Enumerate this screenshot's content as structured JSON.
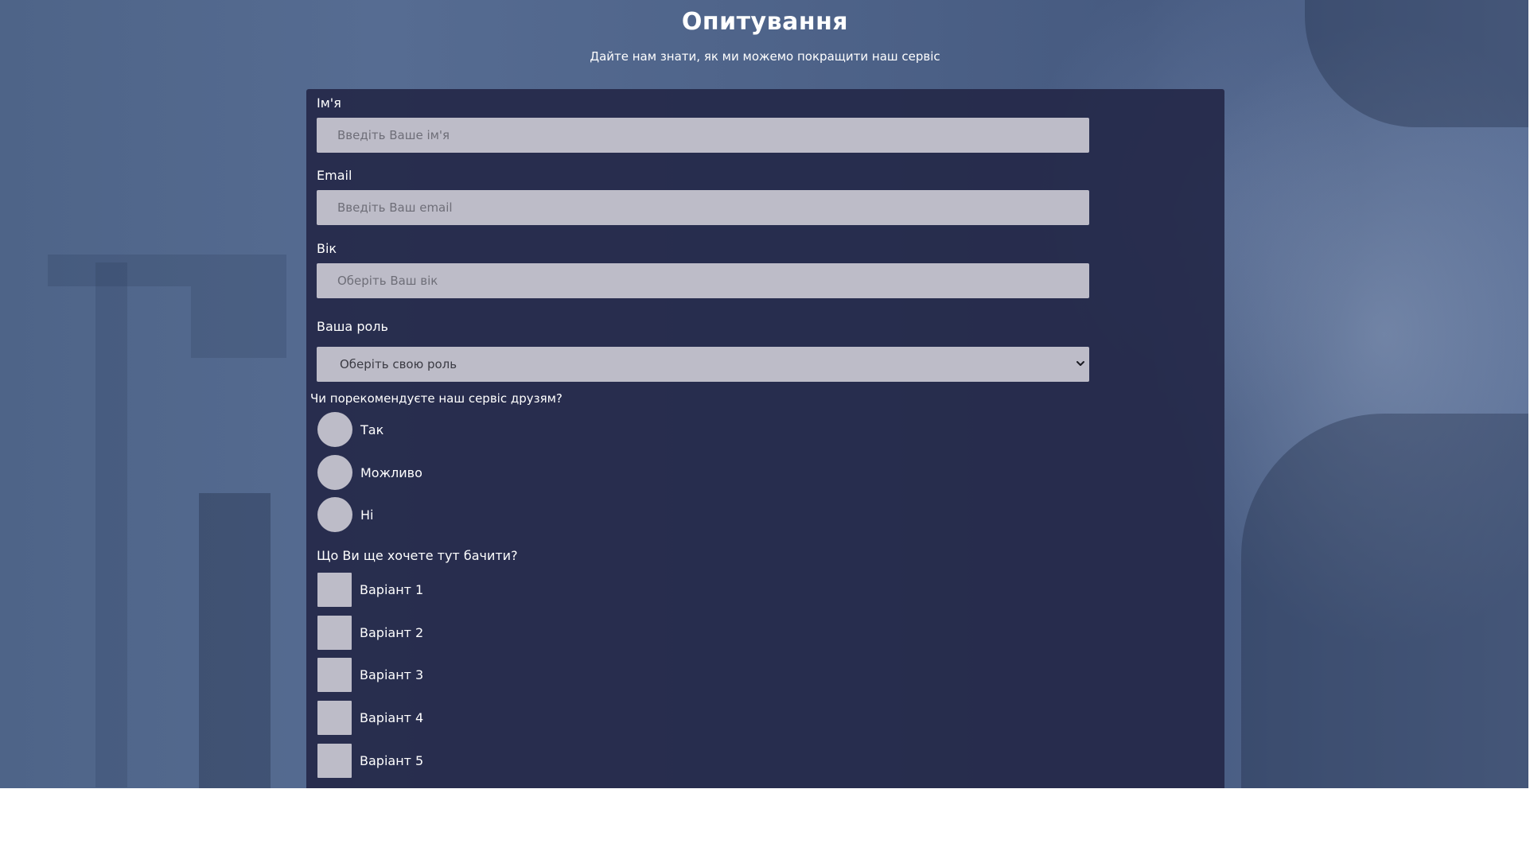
{
  "header": {
    "title": "Опитування",
    "subtitle": "Дайте нам знати, як ми можемо покращити наш сервіс"
  },
  "form": {
    "name": {
      "label": "Ім'я",
      "placeholder": "Введіть Ваше ім'я"
    },
    "email": {
      "label": "Email",
      "placeholder": "Введіть Ваш email"
    },
    "age": {
      "label": "Вік",
      "placeholder": "Оберіть Ваш вік"
    },
    "role": {
      "label": "Ваша роль",
      "selected": "Оберіть свою роль"
    },
    "recommend": {
      "question": "Чи порекомендуєте наш сервіс друзям?",
      "options": [
        "Так",
        "Можливо",
        "Ні"
      ]
    },
    "features": {
      "question": "Що Ви ще хочете тут бачити?",
      "options": [
        "Варіант 1",
        "Варіант 2",
        "Варіант 3",
        "Варіант 4",
        "Варіант 5"
      ]
    }
  },
  "colors": {
    "panel": "#252949",
    "input": "#bdbcc8",
    "background": "#4e6488"
  },
  "icons": {
    "select_arrow": "chevron-down-icon"
  }
}
